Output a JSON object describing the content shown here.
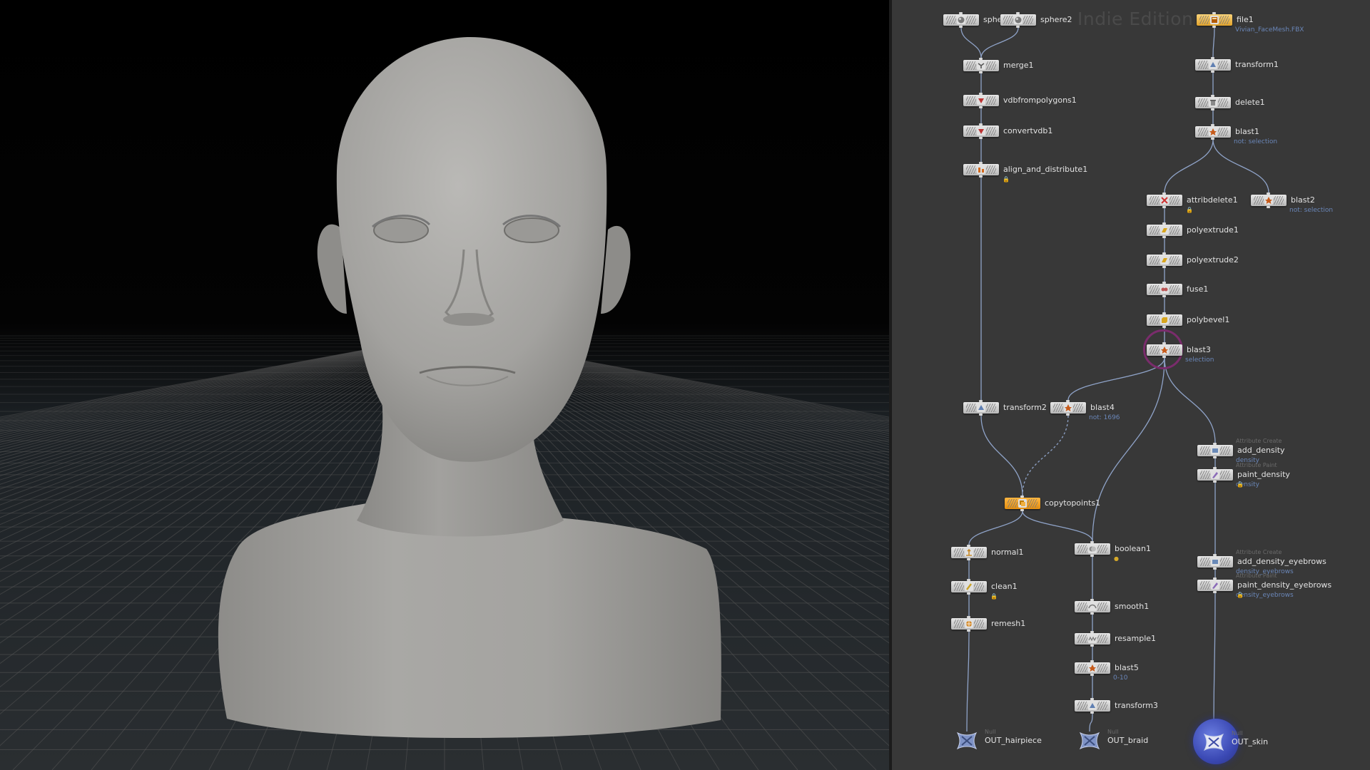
{
  "viewport": {
    "background": "#000000",
    "grid_color": "#5a5a5a",
    "model_color": "#a7a6a4",
    "model": "head-and-shoulders-bust"
  },
  "network": {
    "background": "#383838",
    "watermark": "Indie Edition",
    "wire_color": "#8fa3c8",
    "selection_ring_color": "#7a2c6c",
    "nodes": {
      "sphere1": {
        "label": "sphere1",
        "icon": "sphere-icon"
      },
      "sphere2": {
        "label": "sphere2",
        "icon": "sphere-icon"
      },
      "file1": {
        "label": "file1",
        "sub": "Vivian_FaceMesh.FBX",
        "icon": "file-icon",
        "color": "#f2c45a"
      },
      "merge1": {
        "label": "merge1",
        "icon": "merge-icon"
      },
      "transform1": {
        "label": "transform1",
        "icon": "transform-icon"
      },
      "vdbfrompolygons1": {
        "label": "vdbfrompolygons1",
        "icon": "vdb-icon"
      },
      "delete1": {
        "label": "delete1",
        "icon": "delete-icon"
      },
      "convertvdb1": {
        "label": "convertvdb1",
        "icon": "vdb-icon"
      },
      "blast1": {
        "label": "blast1",
        "sub": "not: selection",
        "icon": "blast-icon"
      },
      "align_and_distribute1": {
        "label": "align_and_distribute1",
        "icon": "align-icon"
      },
      "attribdelete1": {
        "label": "attribdelete1",
        "icon": "attribdelete-icon"
      },
      "blast2": {
        "label": "blast2",
        "sub": "not: selection",
        "icon": "blast-icon"
      },
      "polyextrude1": {
        "label": "polyextrude1",
        "icon": "polyextrude-icon"
      },
      "polyextrude2": {
        "label": "polyextrude2",
        "icon": "polyextrude-icon"
      },
      "fuse1": {
        "label": "fuse1",
        "icon": "fuse-icon"
      },
      "polybevel1": {
        "label": "polybevel1",
        "icon": "polybevel-icon"
      },
      "blast3": {
        "label": "blast3",
        "sub": "selection",
        "icon": "blast-icon"
      },
      "transform2": {
        "label": "transform2",
        "icon": "transform-icon"
      },
      "blast4": {
        "label": "blast4",
        "sub": "not: 1696",
        "icon": "blast-icon"
      },
      "add_density": {
        "label": "add_density",
        "type": "Attribute Create",
        "sub": "density",
        "icon": "attribcreate-icon"
      },
      "paint_density": {
        "label": "paint_density",
        "type": "Attribute Paint",
        "sub": "density",
        "icon": "attribpaint-icon"
      },
      "copytopoints1": {
        "label": "copytopoints1",
        "icon": "copy-icon",
        "color": "#f0a020"
      },
      "normal1": {
        "label": "normal1",
        "icon": "normal-icon"
      },
      "boolean1": {
        "label": "boolean1",
        "icon": "boolean-icon"
      },
      "add_density_eyebrows": {
        "label": "add_density_eyebrows",
        "type": "Attribute Create",
        "sub": "density_eyebrows",
        "icon": "attribcreate-icon"
      },
      "paint_density_eyebrows": {
        "label": "paint_density_eyebrows",
        "type": "Attribute Paint",
        "sub": "density_eyebrows",
        "icon": "attribpaint-icon"
      },
      "clean1": {
        "label": "clean1",
        "icon": "clean-icon"
      },
      "smooth1": {
        "label": "smooth1",
        "icon": "smooth-icon"
      },
      "remesh1": {
        "label": "remesh1",
        "icon": "remesh-icon"
      },
      "resample1": {
        "label": "resample1",
        "icon": "resample-icon"
      },
      "blast5": {
        "label": "blast5",
        "sub": "0-10",
        "icon": "blast-icon"
      },
      "transform3": {
        "label": "transform3",
        "icon": "transform-icon"
      },
      "OUT_hairpiece": {
        "label": "OUT_hairpiece",
        "type": "Null",
        "icon": "null-icon"
      },
      "OUT_braid": {
        "label": "OUT_braid",
        "type": "Null",
        "icon": "null-icon"
      },
      "OUT_skin": {
        "label": "OUT_skin",
        "type": "Null",
        "icon": "null-icon"
      }
    }
  }
}
